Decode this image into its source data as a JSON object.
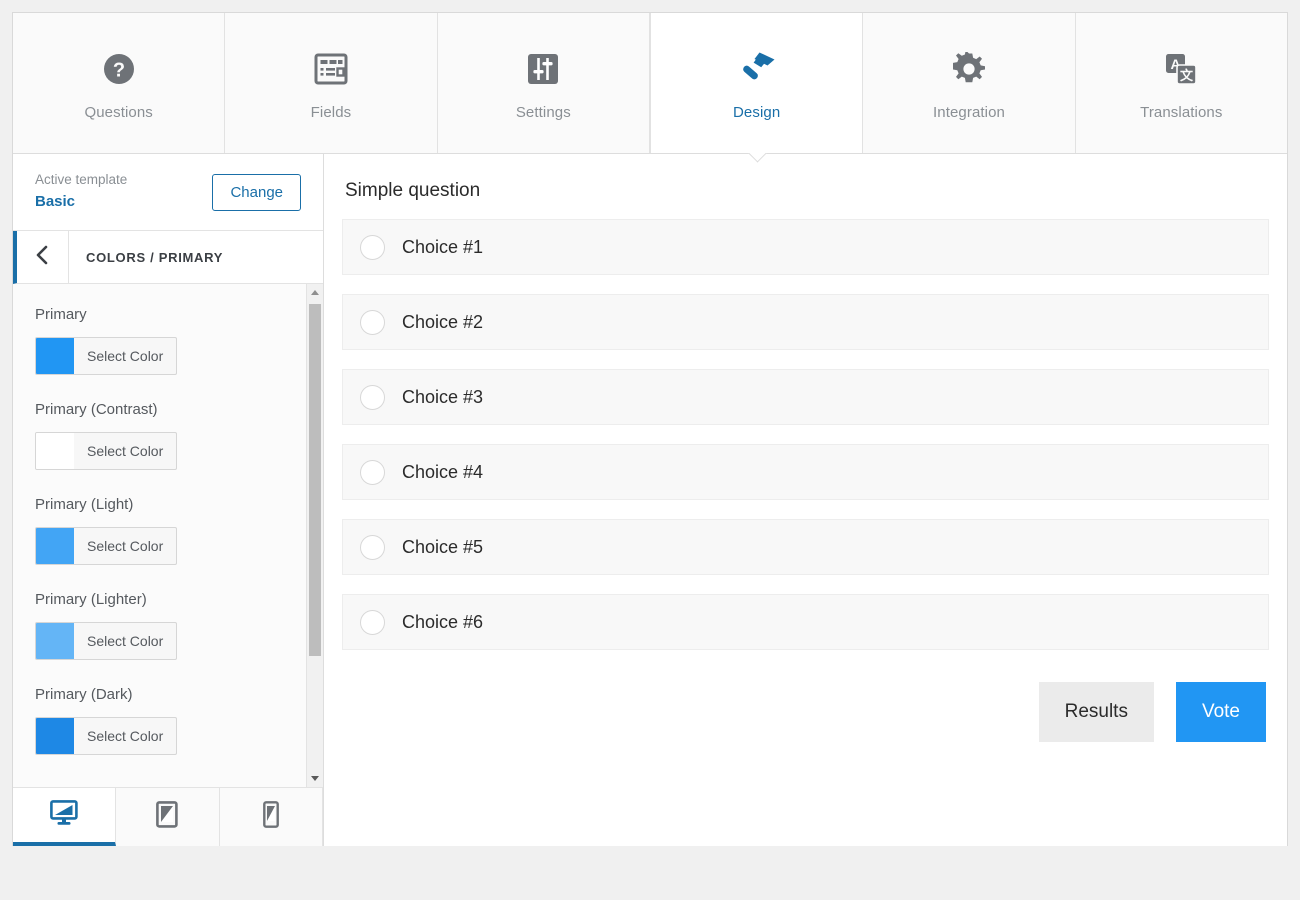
{
  "tabs": [
    {
      "label": "Questions",
      "icon": "question-mark-circle-icon",
      "active": false
    },
    {
      "label": "Fields",
      "icon": "form-fields-icon",
      "active": false
    },
    {
      "label": "Settings",
      "icon": "sliders-icon",
      "active": false
    },
    {
      "label": "Design",
      "icon": "hammer-icon",
      "active": true
    },
    {
      "label": "Integration",
      "icon": "gear-icon",
      "active": false
    },
    {
      "label": "Translations",
      "icon": "translate-icon",
      "active": false
    }
  ],
  "sidebar": {
    "template": {
      "caption": "Active template",
      "name": "Basic",
      "change_label": "Change"
    },
    "section": {
      "back_icon": "chevron-left-icon",
      "title": "COLORS / PRIMARY"
    },
    "select_color_label": "Select Color",
    "colors": [
      {
        "label": "Primary",
        "value": "#2196f3"
      },
      {
        "label": "Primary (Contrast)",
        "value": "#ffffff"
      },
      {
        "label": "Primary (Light)",
        "value": "#42a5f5"
      },
      {
        "label": "Primary (Lighter)",
        "value": "#64b5f6"
      },
      {
        "label": "Primary (Dark)",
        "value": "#1e88e5"
      }
    ],
    "devices": [
      {
        "name": "desktop",
        "icon": "monitor-icon",
        "active": true
      },
      {
        "name": "tablet",
        "icon": "tablet-icon",
        "active": false
      },
      {
        "name": "mobile",
        "icon": "phone-icon",
        "active": false
      }
    ]
  },
  "preview": {
    "question_title": "Simple question",
    "choices": [
      "Choice #1",
      "Choice #2",
      "Choice #3",
      "Choice #4",
      "Choice #5",
      "Choice #6"
    ],
    "results_label": "Results",
    "vote_label": "Vote"
  },
  "theme": {
    "accent": "#1a6fa8",
    "primary": "#2196f3",
    "muted_text": "#8a8f94"
  }
}
